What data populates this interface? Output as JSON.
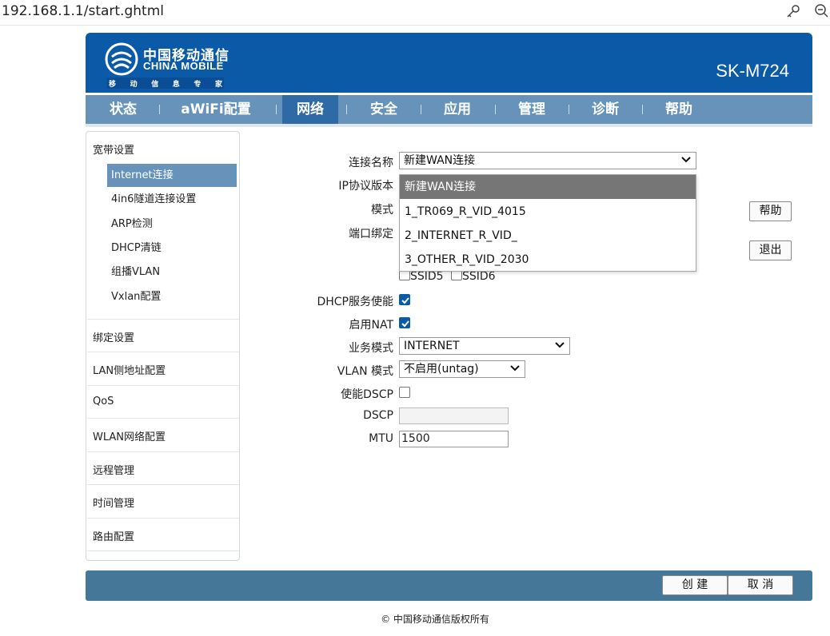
{
  "browser": {
    "url": "192.168.1.1/start.ghtml",
    "icons": [
      "key-icon",
      "zoom-icon"
    ]
  },
  "header": {
    "brand_cn": "中国移动通信",
    "brand_en": "CHINA MOBILE",
    "brand_tagline": [
      "移",
      "动",
      "信",
      "息",
      "专",
      "家"
    ],
    "model": "SK-M724",
    "colors": {
      "banner": "#0a5aa8",
      "nav": "#6793bb",
      "nav_active": "#2e6aa6",
      "footer": "#457799"
    }
  },
  "nav": {
    "items": [
      {
        "label": "状态"
      },
      {
        "label": "aWiFi配置"
      },
      {
        "label": "网络"
      },
      {
        "label": "安全"
      },
      {
        "label": "应用"
      },
      {
        "label": "管理"
      },
      {
        "label": "诊断"
      },
      {
        "label": "帮助"
      }
    ],
    "active": "网络"
  },
  "sidebar": {
    "groups": [
      "宽带设置",
      "绑定设置",
      "LAN侧地址配置",
      "QoS",
      "WLAN网络配置",
      "远程管理",
      "时间管理",
      "路由配置"
    ],
    "sub_items": [
      "Internet连接",
      "4in6隧道连接设置",
      "ARP检测",
      "DHCP清链",
      "组播VLAN",
      "Vxlan配置"
    ],
    "active": "Internet连接"
  },
  "form": {
    "connection_name_label": "连接名称",
    "connection_name_value": "新建WAN连接",
    "dropdown_options": [
      "新建WAN连接",
      "1_TR069_R_VID_4015",
      "2_INTERNET_R_VID_",
      "3_OTHER_R_VID_2030"
    ],
    "highlighted_option": "新建WAN连接",
    "ip_version_label": "IP协议版本",
    "mode_label": "模式",
    "port_binding_label": "端口绑定",
    "ssid5_label": "SSID5",
    "ssid6_label": "SSID6",
    "dhcp_label": "DHCP服务使能",
    "dhcp_checked": true,
    "nat_label": "启用NAT",
    "nat_checked": true,
    "service_mode_label": "业务模式",
    "service_mode_value": "INTERNET",
    "vlan_mode_label": "VLAN 模式",
    "vlan_mode_value": "不启用(untag)",
    "dscp_enable_label": "使能DSCP",
    "dscp_enable_checked": false,
    "dscp_label": "DSCP",
    "dscp_value": "",
    "mtu_label": "MTU",
    "mtu_value": "1500"
  },
  "buttons": {
    "help": "帮助",
    "logout": "退出",
    "create": "创 建",
    "cancel": "取 消"
  },
  "footer": {
    "copyright": "© 中国移动通信版权所有"
  }
}
